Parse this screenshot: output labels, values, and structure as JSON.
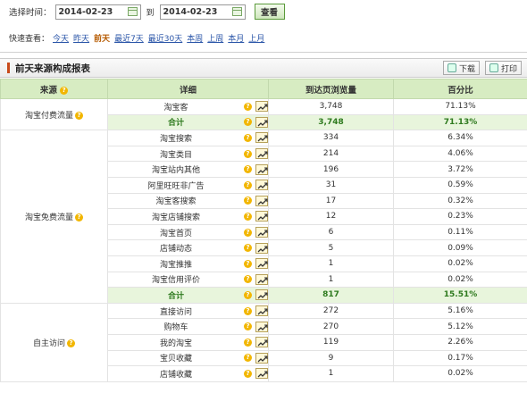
{
  "filter": {
    "label": "选择时间：",
    "start": "2014-02-23",
    "to": "到",
    "end": "2014-02-23",
    "button": "查看"
  },
  "quick": {
    "label": "快速查看：",
    "links": [
      "今天",
      "昨天",
      "前天",
      "最近7天",
      "最近30天",
      "本周",
      "上周",
      "本月",
      "上月"
    ],
    "active": "前天"
  },
  "panel": {
    "title": "前天来源构成报表",
    "download": "下载",
    "print": "打印"
  },
  "table": {
    "headers": [
      "来源",
      "详细",
      "到达页浏览量",
      "百分比"
    ],
    "groups": [
      {
        "source": "淘宝付费流量",
        "rows": [
          {
            "detail": "淘宝客",
            "views": "3,748",
            "pct": "71.13%"
          }
        ],
        "total": {
          "label": "合计",
          "views": "3,748",
          "pct": "71.13%"
        }
      },
      {
        "source": "淘宝免费流量",
        "rows": [
          {
            "detail": "淘宝搜索",
            "views": "334",
            "pct": "6.34%"
          },
          {
            "detail": "淘宝类目",
            "views": "214",
            "pct": "4.06%"
          },
          {
            "detail": "淘宝站内其他",
            "views": "196",
            "pct": "3.72%"
          },
          {
            "detail": "阿里旺旺非广告",
            "views": "31",
            "pct": "0.59%"
          },
          {
            "detail": "淘宝客搜索",
            "views": "17",
            "pct": "0.32%"
          },
          {
            "detail": "淘宝店铺搜索",
            "views": "12",
            "pct": "0.23%"
          },
          {
            "detail": "淘宝首页",
            "views": "6",
            "pct": "0.11%"
          },
          {
            "detail": "店铺动态",
            "views": "5",
            "pct": "0.09%"
          },
          {
            "detail": "淘宝推推",
            "views": "1",
            "pct": "0.02%"
          },
          {
            "detail": "淘宝信用评价",
            "views": "1",
            "pct": "0.02%"
          }
        ],
        "total": {
          "label": "合计",
          "views": "817",
          "pct": "15.51%"
        }
      },
      {
        "source": "自主访问",
        "rows": [
          {
            "detail": "直接访问",
            "views": "272",
            "pct": "5.16%"
          },
          {
            "detail": "购物车",
            "views": "270",
            "pct": "5.12%"
          },
          {
            "detail": "我的淘宝",
            "views": "119",
            "pct": "2.26%"
          },
          {
            "detail": "宝贝收藏",
            "views": "9",
            "pct": "0.17%"
          },
          {
            "detail": "店铺收藏",
            "views": "1",
            "pct": "0.02%"
          }
        ],
        "total": null
      }
    ]
  },
  "icons": {
    "help": "question-icon",
    "trend": "trend-chart-icon",
    "calendar": "calendar-icon"
  }
}
